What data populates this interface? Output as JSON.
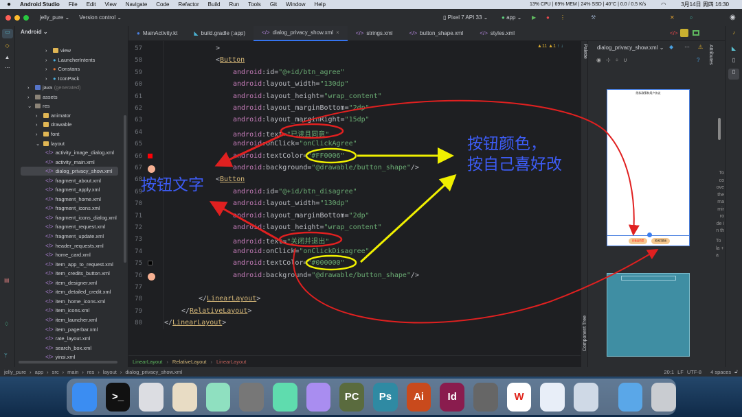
{
  "menubar": {
    "app": "Android Studio",
    "items": [
      "File",
      "Edit",
      "View",
      "Navigate",
      "Code",
      "Refactor",
      "Build",
      "Run",
      "Tools",
      "Git",
      "Window",
      "Help"
    ],
    "stats": "13% CPU | 69% MEM | 24% SSD | 40°C | 0.0 / 0.5 K/s",
    "datetime": "3月14日 周四 16:30"
  },
  "titlebar": {
    "project": "jelly_pure",
    "vcs": "Version control",
    "device": "Pixel 7 API 33",
    "run_config": "app"
  },
  "project_view": {
    "label": "Android"
  },
  "tabs": [
    {
      "label": "MainActivity.kt",
      "icon": "kotlin-class-icon"
    },
    {
      "label": "build.gradle (:app)",
      "icon": "gradle-icon"
    },
    {
      "label": "dialog_privacy_show.xml",
      "icon": "xml-icon",
      "active": true
    },
    {
      "label": "strings.xml",
      "icon": "xml-icon"
    },
    {
      "label": "button_shape.xml",
      "icon": "xml-icon"
    },
    {
      "label": "styles.xml",
      "icon": "xml-icon"
    }
  ],
  "tree": [
    {
      "label": "view",
      "depth": 3,
      "icon": "folder"
    },
    {
      "label": "LauncherIntents",
      "depth": 3,
      "icon": "class"
    },
    {
      "label": "Constans",
      "depth": 3,
      "icon": "class"
    },
    {
      "label": "IconPack",
      "depth": 3,
      "icon": "class"
    },
    {
      "label": "java",
      "suffix": "(generated)",
      "depth": 1,
      "icon": "folder-b"
    },
    {
      "label": "assets",
      "depth": 1,
      "icon": "folder-g"
    },
    {
      "label": "res",
      "depth": 1,
      "icon": "folder-g",
      "open": true
    },
    {
      "label": "animator",
      "depth": 2,
      "icon": "folder"
    },
    {
      "label": "drawable",
      "depth": 2,
      "icon": "folder"
    },
    {
      "label": "font",
      "depth": 2,
      "icon": "folder"
    },
    {
      "label": "layout",
      "depth": 2,
      "icon": "folder",
      "open": true
    },
    {
      "label": "activity_image_dialog.xml",
      "depth": 3
    },
    {
      "label": "activity_main.xml",
      "depth": 3
    },
    {
      "label": "dialog_privacy_show.xml",
      "depth": 3,
      "selected": true
    },
    {
      "label": "fragment_about.xml",
      "depth": 3
    },
    {
      "label": "fragment_apply.xml",
      "depth": 3
    },
    {
      "label": "fragment_home.xml",
      "depth": 3
    },
    {
      "label": "fragment_icons.xml",
      "depth": 3
    },
    {
      "label": "fragment_icons_dialog.xml",
      "depth": 3
    },
    {
      "label": "fragment_request.xml",
      "depth": 3
    },
    {
      "label": "fragment_update.xml",
      "depth": 3
    },
    {
      "label": "header_requests.xml",
      "depth": 3
    },
    {
      "label": "home_card.xml",
      "depth": 3
    },
    {
      "label": "item_app_to_request.xml",
      "depth": 3
    },
    {
      "label": "item_credits_button.xml",
      "depth": 3
    },
    {
      "label": "item_designer.xml",
      "depth": 3
    },
    {
      "label": "item_detailed_credit.xml",
      "depth": 3
    },
    {
      "label": "item_home_icons.xml",
      "depth": 3
    },
    {
      "label": "item_icons.xml",
      "depth": 3
    },
    {
      "label": "item_launcher.xml",
      "depth": 3
    },
    {
      "label": "item_pagerbar.xml",
      "depth": 3
    },
    {
      "label": "rate_layout.xml",
      "depth": 3
    },
    {
      "label": "search_box.xml",
      "depth": 3
    },
    {
      "label": "yinsi.xml",
      "depth": 3
    }
  ],
  "code": [
    {
      "n": 57,
      "i": 3,
      "t": [
        [
          "p",
          ">"
        ]
      ]
    },
    {
      "n": 58,
      "i": 3,
      "t": [
        [
          "p",
          "<"
        ],
        [
          "tg",
          "Button"
        ]
      ]
    },
    {
      "n": 59,
      "i": 4,
      "t": [
        [
          "k",
          "android"
        ],
        [
          "p",
          ":id="
        ],
        [
          "s",
          "\"@+id/btn_agree\""
        ]
      ]
    },
    {
      "n": 60,
      "i": 4,
      "t": [
        [
          "k",
          "android"
        ],
        [
          "p",
          ":layout_width="
        ],
        [
          "s",
          "\"130dp\""
        ]
      ]
    },
    {
      "n": 61,
      "i": 4,
      "t": [
        [
          "k",
          "android"
        ],
        [
          "p",
          ":layout_height="
        ],
        [
          "s",
          "\"wrap_content\""
        ]
      ]
    },
    {
      "n": 62,
      "i": 4,
      "t": [
        [
          "k",
          "android"
        ],
        [
          "p",
          ":layout_marginBottom="
        ],
        [
          "s",
          "\"2dp\""
        ]
      ]
    },
    {
      "n": 63,
      "i": 4,
      "t": [
        [
          "k",
          "android"
        ],
        [
          "p",
          ":layout_marginRight="
        ],
        [
          "s",
          "\"15dp\""
        ]
      ]
    },
    {
      "n": 64,
      "i": 4,
      "t": [
        [
          "k",
          "android"
        ],
        [
          "p",
          ":text="
        ],
        [
          "s",
          "\"已读且同意\""
        ]
      ]
    },
    {
      "n": 65,
      "i": 4,
      "t": [
        [
          "k",
          "android"
        ],
        [
          "p",
          ":onClick="
        ],
        [
          "s",
          "\"onClickAgree\""
        ]
      ]
    },
    {
      "n": 66,
      "i": 4,
      "t": [
        [
          "k",
          "android"
        ],
        [
          "p",
          ":textColor="
        ],
        [
          "s",
          "\"#FF0006\""
        ]
      ],
      "swatch": "#FF0006"
    },
    {
      "n": 67,
      "i": 4,
      "t": [
        [
          "k",
          "android"
        ],
        [
          "p",
          ":background="
        ],
        [
          "s",
          "\"@drawable/button_shape\""
        ],
        [
          "p",
          "/>"
        ]
      ],
      "swatch": "#f6b092"
    },
    {
      "n": 68,
      "i": 3,
      "t": [
        [
          "p",
          "<"
        ],
        [
          "tg",
          "Button"
        ]
      ]
    },
    {
      "n": 69,
      "i": 4,
      "t": [
        [
          "k",
          "android"
        ],
        [
          "p",
          ":id="
        ],
        [
          "s",
          "\"@+id/btn_disagree\""
        ]
      ]
    },
    {
      "n": 70,
      "i": 4,
      "t": [
        [
          "k",
          "android"
        ],
        [
          "p",
          ":layout_width="
        ],
        [
          "s",
          "\"130dp\""
        ]
      ]
    },
    {
      "n": 71,
      "i": 4,
      "t": [
        [
          "k",
          "android"
        ],
        [
          "p",
          ":layout_marginBottom="
        ],
        [
          "s",
          "\"2dp\""
        ]
      ]
    },
    {
      "n": 72,
      "i": 4,
      "t": [
        [
          "k",
          "android"
        ],
        [
          "p",
          ":layout_height="
        ],
        [
          "s",
          "\"wrap_content\""
        ]
      ]
    },
    {
      "n": 73,
      "i": 4,
      "t": [
        [
          "k",
          "android"
        ],
        [
          "p",
          ":text="
        ],
        [
          "s",
          "\"关闭并退出\""
        ]
      ]
    },
    {
      "n": 74,
      "i": 4,
      "t": [
        [
          "k",
          "android"
        ],
        [
          "p",
          ":onClick="
        ],
        [
          "s",
          "\"onClickDisagree\""
        ]
      ]
    },
    {
      "n": 75,
      "i": 4,
      "t": [
        [
          "k",
          "android"
        ],
        [
          "p",
          ":textColor="
        ],
        [
          "s",
          "\"#000000\""
        ]
      ],
      "swatch": "#000000"
    },
    {
      "n": 76,
      "i": 4,
      "t": [
        [
          "k",
          "android"
        ],
        [
          "p",
          ":background="
        ],
        [
          "s",
          "\"@drawable/button_shape\""
        ],
        [
          "p",
          "/>"
        ]
      ],
      "swatch": "#f6b092"
    },
    {
      "n": 77,
      "i": 0,
      "t": []
    },
    {
      "n": 78,
      "i": 2,
      "t": [
        [
          "p",
          "</"
        ],
        [
          "tg",
          "LinearLayout"
        ],
        [
          "p",
          ">"
        ]
      ]
    },
    {
      "n": 79,
      "i": 1,
      "t": [
        [
          "p",
          "</"
        ],
        [
          "tg",
          "RelativeLayout"
        ],
        [
          "p",
          ">"
        ]
      ]
    },
    {
      "n": 80,
      "i": 0,
      "t": [
        [
          "p",
          "</"
        ],
        [
          "tg",
          "LinearLayout"
        ],
        [
          "p",
          ">"
        ]
      ]
    }
  ],
  "inspections": {
    "warnings": "11",
    "weak_warnings": "1"
  },
  "annotations": {
    "button_text": "按钮文字",
    "button_color_1": "按钮颜色，",
    "button_color_2": "按自己喜好改"
  },
  "breadcrumb": [
    "LinearLayout",
    "RelativeLayout",
    "LinearLayout"
  ],
  "preview": {
    "file": "dialog_privacy_show.xml",
    "palette": "Palette",
    "attributes": "Attributes",
    "component_tree": "Component Tree",
    "phone_title": "隐私政策和用户协议",
    "btn_agree": "已读且同意",
    "btn_disagree": "关闭并退出",
    "hint": "To co ove the ma mirro de in th",
    "hint2": "To la + a"
  },
  "statusbar": {
    "path": [
      "jelly_pure",
      "app",
      "src",
      "main",
      "res",
      "layout",
      "dialog_privacy_show.xml"
    ],
    "position": "20:1",
    "line_sep": "LF",
    "encoding": "UTF-8",
    "indent": "4 spaces"
  },
  "dock": [
    {
      "name": "Finder",
      "c": "#3b8df2"
    },
    {
      "name": "Terminal",
      "c": "#111",
      "t": ">_"
    },
    {
      "name": "Launchpad",
      "c": "#dcdde2"
    },
    {
      "name": "QQ",
      "c": "#e8dcc4"
    },
    {
      "name": "App",
      "c": "#8fe0c0"
    },
    {
      "name": "App",
      "c": "#777"
    },
    {
      "name": "Android Studio",
      "c": "#5fdcae"
    },
    {
      "name": "App",
      "c": "#a98df0"
    },
    {
      "name": "PyCharm",
      "c": "#5a6b3e",
      "t": "PC"
    },
    {
      "name": "Photoshop",
      "c": "#2f8aa3",
      "t": "Ps"
    },
    {
      "name": "Illustrator",
      "c": "#c94a1c",
      "t": "Ai"
    },
    {
      "name": "InDesign",
      "c": "#8a1c4e",
      "t": "Id"
    },
    {
      "name": "System Settings",
      "c": "#666"
    },
    {
      "name": "WPS",
      "c": "#fff",
      "t": "W",
      "tc": "#e0241b"
    },
    {
      "name": "Safari",
      "c": "#e8eef8"
    },
    {
      "name": "Preview",
      "c": "#cfd9e6"
    },
    {
      "name": "Downloads",
      "c": "#5aa7e8"
    },
    {
      "name": "Trash",
      "c": "#c9ccd1"
    }
  ]
}
